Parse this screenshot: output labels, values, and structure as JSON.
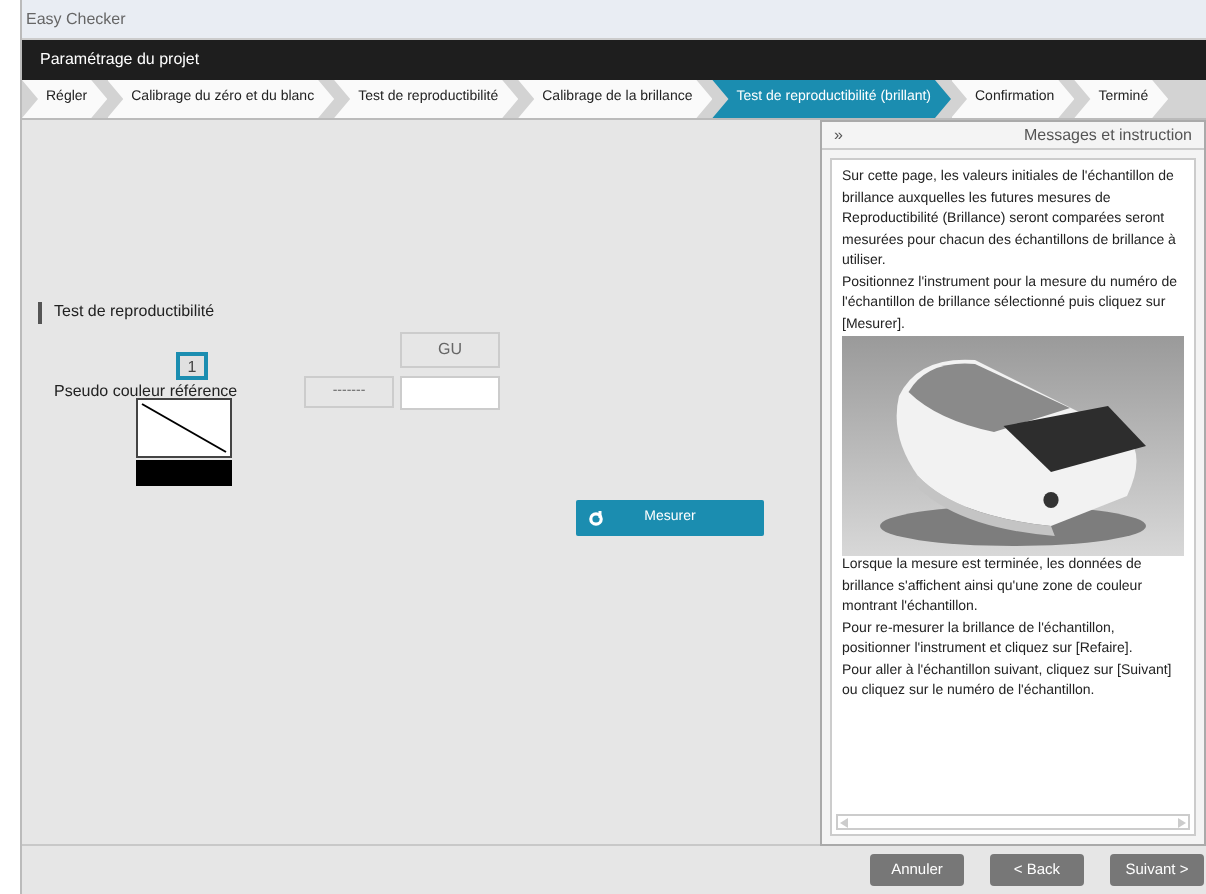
{
  "window": {
    "title": "Easy Checker"
  },
  "header": {
    "title": "Paramétrage du projet"
  },
  "steps": [
    {
      "label": "Régler",
      "selected": false
    },
    {
      "label": "Calibrage du zéro et du blanc",
      "selected": false
    },
    {
      "label": "Test de reproductibilité",
      "selected": false
    },
    {
      "label": "Calibrage de la brillance",
      "selected": false
    },
    {
      "label": "Test de reproductibilité (brillant)",
      "selected": true
    },
    {
      "label": "Confirmation",
      "selected": false
    },
    {
      "label": "Terminé",
      "selected": false
    }
  ],
  "main": {
    "section_title": "Test de reproductibilité",
    "samples": [
      {
        "label": "1",
        "selected": true
      }
    ],
    "unit": "GU",
    "row_label": "-------",
    "pseudo_color_label": "Pseudo couleur référence",
    "measure_button": "Mesurer"
  },
  "panel": {
    "collapse": "»",
    "title": "Messages et instruction",
    "paragraphs_before": [
      "Sur cette page, les valeurs initiales de l'échantillon de brillance auxquelles les futures mesures de Reproductibilité (Brillance) seront comparées seront mesurées pour chacun des échantillons de brillance à utiliser.",
      "Positionnez l'instrument pour la mesure du numéro de l'échantillon de brillance sélectionné puis cliquez sur [Mesurer]."
    ],
    "picture": {
      "kind": "picture"
    },
    "paragraphs_after": [
      "Lorsque la mesure est terminée, les données de brillance s'affichent ainsi qu'une zone de couleur montrant l'échantillon.",
      "Pour re-mesurer la brillance de l'échantillon, positionner l'instrument et cliquez sur [Refaire].",
      "Pour aller à l'échantillon suivant, cliquez sur [Suivant] ou cliquez sur le numéro de l'échantillon."
    ]
  },
  "buttons": [
    "Annuler",
    "< Back",
    "Suivant >"
  ]
}
